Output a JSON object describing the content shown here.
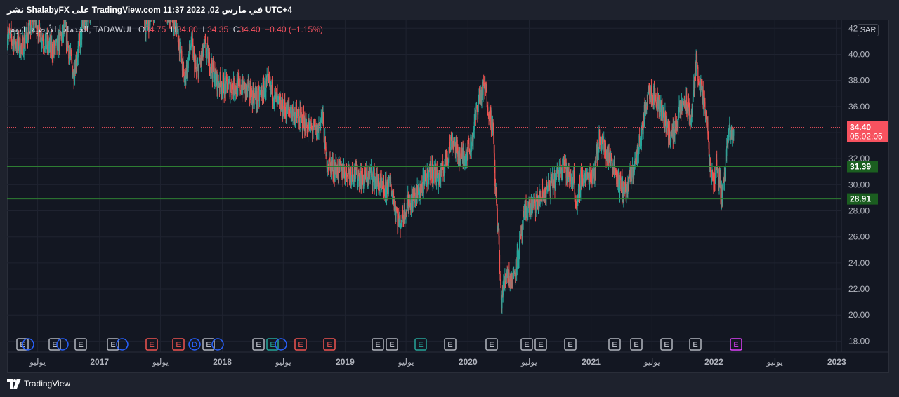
{
  "header": {
    "title": "نشر ShalabyFX على TradingView.com في مارس 02, 2022 11:37 UTC+4"
  },
  "legend": {
    "symbol": "الخدمات الأرضية, 1يوم, TADAWUL",
    "o_label": "O",
    "o_value": "34.75",
    "h_label": "H",
    "h_value": "34.80",
    "l_label": "L",
    "l_value": "34.35",
    "c_label": "C",
    "c_value": "34.40",
    "change": "−0.40 (−1.15%)"
  },
  "currency_badge": "SAR",
  "price_scale": {
    "ticks": [
      "42.00",
      "40.00",
      "38.00",
      "36.00",
      "34.00",
      "32.00",
      "30.00",
      "28.00",
      "26.00",
      "24.00",
      "22.00",
      "20.00",
      "18.00"
    ],
    "current_price": "34.40",
    "countdown": "05:02:05",
    "support_1": "31.39",
    "support_2": "28.91"
  },
  "time_scale": {
    "labels": [
      "يوليو",
      "2017",
      "يوليو",
      "2018",
      "يوليو",
      "2019",
      "يوليو",
      "2020",
      "يوليو",
      "2021",
      "يوليو",
      "2022",
      "يوليو",
      "2023"
    ]
  },
  "events": {
    "markers": [
      {
        "label": "E",
        "type": "e-gray"
      },
      {
        "label": "",
        "type": "d-blue"
      },
      {
        "label": "E",
        "type": "e-gray"
      },
      {
        "label": "",
        "type": "d-blue"
      },
      {
        "label": "E",
        "type": "e-gray"
      },
      {
        "label": "E",
        "type": "e-gray"
      },
      {
        "label": "",
        "type": "d-blue"
      },
      {
        "label": "E",
        "type": "e-red"
      },
      {
        "label": "E",
        "type": "e-red"
      },
      {
        "label": "D",
        "type": "d-blue"
      },
      {
        "label": "E",
        "type": "e-gray"
      },
      {
        "label": "",
        "type": "d-blue"
      },
      {
        "label": "E",
        "type": "e-gray"
      },
      {
        "label": "E",
        "type": "e-green"
      },
      {
        "label": "",
        "type": "d-blue"
      },
      {
        "label": "E",
        "type": "e-red"
      },
      {
        "label": "E",
        "type": "e-red"
      },
      {
        "label": "E",
        "type": "e-gray"
      },
      {
        "label": "E",
        "type": "e-gray"
      },
      {
        "label": "E",
        "type": "e-green"
      },
      {
        "label": "E",
        "type": "e-gray"
      },
      {
        "label": "E",
        "type": "e-gray"
      },
      {
        "label": "E",
        "type": "e-gray"
      },
      {
        "label": "E",
        "type": "e-gray"
      },
      {
        "label": "E",
        "type": "e-gray"
      },
      {
        "label": "E",
        "type": "e-gray"
      },
      {
        "label": "E",
        "type": "e-gray"
      },
      {
        "label": "E",
        "type": "e-gray"
      },
      {
        "label": "E",
        "type": "e-gray"
      },
      {
        "label": "E",
        "type": "e-purple"
      }
    ]
  },
  "footer": {
    "brand": "TradingView"
  },
  "colors": {
    "up": "#26a69a",
    "down": "#ef5350",
    "support": "#1b5e20",
    "price_line": "#f7525f"
  },
  "chart_data": {
    "type": "candlestick",
    "symbol": "الخدمات الأرضية",
    "exchange": "TADAWUL",
    "interval": "1D",
    "ylim": [
      17,
      42.5
    ],
    "xlim": [
      "2016-04-01",
      "2023-01-15"
    ],
    "horizontal_lines": [
      31.39,
      28.91
    ],
    "last_price": 34.4,
    "path": [
      [
        "2016-04-01",
        41.5
      ],
      [
        "2016-05-15",
        40.5
      ],
      [
        "2016-06-20",
        42.8
      ],
      [
        "2016-07-20",
        41.0
      ],
      [
        "2016-08-20",
        40.2
      ],
      [
        "2016-09-20",
        42.0
      ],
      [
        "2016-10-15",
        38.5
      ],
      [
        "2016-11-15",
        42.5
      ],
      [
        "2016-12-20",
        44.0
      ],
      [
        "2017-02-01",
        45.0
      ],
      [
        "2017-04-01",
        46.0
      ],
      [
        "2017-05-01",
        44.5
      ],
      [
        "2017-05-20",
        42.0
      ],
      [
        "2017-06-20",
        44.0
      ],
      [
        "2017-07-20",
        43.5
      ],
      [
        "2017-08-20",
        42.0
      ],
      [
        "2017-09-10",
        38.0
      ],
      [
        "2017-10-01",
        41.0
      ],
      [
        "2017-10-15",
        38.5
      ],
      [
        "2017-11-10",
        40.5
      ],
      [
        "2017-12-15",
        38.0
      ],
      [
        "2018-01-15",
        37.5
      ],
      [
        "2018-03-01",
        37.5
      ],
      [
        "2018-04-15",
        36.5
      ],
      [
        "2018-05-15",
        37.8
      ],
      [
        "2018-06-20",
        36.0
      ],
      [
        "2018-08-01",
        35.5
      ],
      [
        "2018-09-10",
        34.5
      ],
      [
        "2018-10-10",
        34.0
      ],
      [
        "2018-10-25",
        35.5
      ],
      [
        "2018-11-05",
        32.0
      ],
      [
        "2018-11-25",
        31.3
      ],
      [
        "2018-12-25",
        31.0
      ],
      [
        "2019-01-20",
        31.0
      ],
      [
        "2019-02-20",
        30.5
      ],
      [
        "2019-03-20",
        30.8
      ],
      [
        "2019-04-25",
        29.5
      ],
      [
        "2019-05-15",
        30.0
      ],
      [
        "2019-05-25",
        29.0
      ],
      [
        "2019-06-10",
        27.0
      ],
      [
        "2019-07-05",
        28.5
      ],
      [
        "2019-08-10",
        29.5
      ],
      [
        "2019-09-10",
        31.0
      ],
      [
        "2019-10-10",
        30.5
      ],
      [
        "2019-11-15",
        33.5
      ],
      [
        "2019-12-10",
        32.0
      ],
      [
        "2020-01-10",
        33.0
      ],
      [
        "2020-02-01",
        36.5
      ],
      [
        "2020-02-20",
        37.5
      ],
      [
        "2020-03-05",
        35.5
      ],
      [
        "2020-03-15",
        34.5
      ],
      [
        "2020-03-22",
        30.0
      ],
      [
        "2020-04-01",
        26.0
      ],
      [
        "2020-04-08",
        21.0
      ],
      [
        "2020-04-25",
        23.5
      ],
      [
        "2020-05-10",
        22.5
      ],
      [
        "2020-06-01",
        25.0
      ],
      [
        "2020-06-20",
        28.0
      ],
      [
        "2020-07-20",
        28.5
      ],
      [
        "2020-08-20",
        29.5
      ],
      [
        "2020-09-20",
        30.5
      ],
      [
        "2020-10-10",
        32.0
      ],
      [
        "2020-10-25",
        30.5
      ],
      [
        "2020-11-10",
        30.5
      ],
      [
        "2020-11-20",
        28.0
      ],
      [
        "2020-12-01",
        30.5
      ],
      [
        "2020-12-20",
        30.5
      ],
      [
        "2021-01-10",
        31.0
      ],
      [
        "2021-01-25",
        33.5
      ],
      [
        "2021-02-15",
        32.5
      ],
      [
        "2021-03-10",
        31.5
      ],
      [
        "2021-03-25",
        30.0
      ],
      [
        "2021-04-15",
        29.5
      ],
      [
        "2021-05-10",
        31.5
      ],
      [
        "2021-06-01",
        34.0
      ],
      [
        "2021-06-20",
        37.5
      ],
      [
        "2021-07-15",
        36.5
      ],
      [
        "2021-08-10",
        35.0
      ],
      [
        "2021-08-25",
        33.5
      ],
      [
        "2021-09-15",
        35.0
      ],
      [
        "2021-10-05",
        36.5
      ],
      [
        "2021-10-25",
        35.0
      ],
      [
        "2021-11-10",
        39.5
      ],
      [
        "2021-11-25",
        37.0
      ],
      [
        "2021-12-10",
        35.0
      ],
      [
        "2021-12-20",
        31.5
      ],
      [
        "2021-12-28",
        30.0
      ],
      [
        "2022-01-10",
        31.5
      ],
      [
        "2022-01-25",
        29.0
      ],
      [
        "2022-02-05",
        32.0
      ],
      [
        "2022-02-15",
        34.0
      ],
      [
        "2022-02-25",
        33.5
      ],
      [
        "2022-03-02",
        34.4
      ]
    ]
  }
}
